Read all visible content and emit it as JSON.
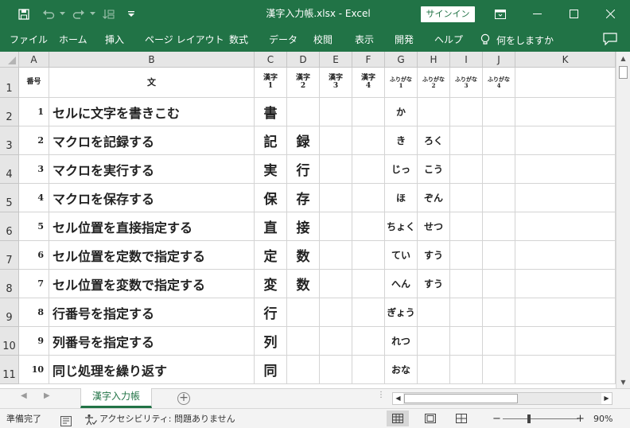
{
  "app": {
    "title": "漢字入力帳.xlsx  -  Excel",
    "signin_label": "サインイン"
  },
  "ribbon": {
    "tabs": [
      "ファイル",
      "ホーム",
      "挿入",
      "ページ レイアウト",
      "数式",
      "データ",
      "校閲",
      "表示",
      "開発",
      "ヘルプ"
    ],
    "tell_me": "何をしますか"
  },
  "sheet": {
    "columns": [
      "A",
      "B",
      "C",
      "D",
      "E",
      "F",
      "G",
      "H",
      "I",
      "J",
      "K"
    ],
    "header_row": {
      "row": "1",
      "a": "番号",
      "b": "文",
      "c": "漢字\n1",
      "d": "漢字\n2",
      "e": "漢字\n3",
      "f": "漢字\n4",
      "g": "ふりがな\n1",
      "h": "ふりがな\n2",
      "i": "ふりがな\n3",
      "j": "ふりがな\n4"
    },
    "rows": [
      {
        "row": "2",
        "num": "1",
        "text": "セルに文字を書きこむ",
        "k1": "書",
        "k2": "",
        "f1": "か",
        "f2": ""
      },
      {
        "row": "3",
        "num": "2",
        "text": "マクロを記録する",
        "k1": "記",
        "k2": "録",
        "f1": "き",
        "f2": "ろく"
      },
      {
        "row": "4",
        "num": "3",
        "text": "マクロを実行する",
        "k1": "実",
        "k2": "行",
        "f1": "じっ",
        "f2": "こう"
      },
      {
        "row": "5",
        "num": "4",
        "text": "マクロを保存する",
        "k1": "保",
        "k2": "存",
        "f1": "ほ",
        "f2": "ぞん"
      },
      {
        "row": "6",
        "num": "5",
        "text": "セル位置を直接指定する",
        "k1": "直",
        "k2": "接",
        "f1": "ちょく",
        "f2": "せつ"
      },
      {
        "row": "7",
        "num": "6",
        "text": "セル位置を定数で指定する",
        "k1": "定",
        "k2": "数",
        "f1": "てい",
        "f2": "すう"
      },
      {
        "row": "8",
        "num": "7",
        "text": "セル位置を変数で指定する",
        "k1": "変",
        "k2": "数",
        "f1": "へん",
        "f2": "すう"
      },
      {
        "row": "9",
        "num": "8",
        "text": "行番号を指定する",
        "k1": "行",
        "k2": "",
        "f1": "ぎょう",
        "f2": ""
      },
      {
        "row": "10",
        "num": "9",
        "text": "列番号を指定する",
        "k1": "列",
        "k2": "",
        "f1": "れつ",
        "f2": ""
      },
      {
        "row": "11",
        "num": "10",
        "text": "同じ処理を繰り返す",
        "k1": "同",
        "k2": "",
        "f1": "おな",
        "f2": ""
      }
    ],
    "active_tab": "漢字入力帳"
  },
  "status": {
    "ready": "準備完了",
    "accessibility": "アクセシビリティ: 問題ありません",
    "zoom": "90%",
    "zoom_minus": "−",
    "zoom_plus": "+"
  },
  "colors": {
    "accent": "#217346",
    "header_bg": "#e6e6e6",
    "gridline": "#d4d4d4"
  }
}
